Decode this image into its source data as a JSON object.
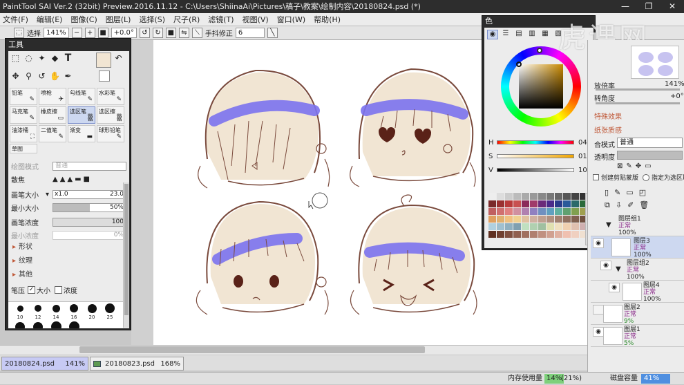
{
  "window": {
    "title": "PaintTool SAI Ver.2 (32bit) Preview.2016.11.12 - C:\\Users\\ShiinaAi\\Pictures\\稿子\\教案\\绘制内容\\20180824.psd (*)",
    "controls": [
      "—",
      "❐",
      "✕"
    ]
  },
  "menu": [
    "文件(F)",
    "编辑(E)",
    "图像(C)",
    "图层(L)",
    "选择(S)",
    "尺子(R)",
    "滤镜(T)",
    "视图(V)",
    "窗口(W)",
    "帮助(H)"
  ],
  "toolbar": {
    "select_label": "选择",
    "zoom": "141%",
    "angle": "+0.0°",
    "stabilizer_label": "手抖修正",
    "stabilizer_value": "6"
  },
  "tools_window": {
    "title": "工具",
    "brushes": [
      {
        "name": "铅笔",
        "glyph": "✎"
      },
      {
        "name": "喷枪",
        "glyph": "✈"
      },
      {
        "name": "勾线笔",
        "glyph": "✎"
      },
      {
        "name": "水彩笔",
        "glyph": "✎"
      },
      {
        "name": "马克笔",
        "glyph": "✎"
      },
      {
        "name": "橡皮擦",
        "glyph": "▭"
      },
      {
        "name": "选区笔",
        "glyph": "▒"
      },
      {
        "name": "选区擦",
        "glyph": "▒"
      },
      {
        "name": "油漆桶",
        "glyph": "⛶"
      },
      {
        "name": "二值笔",
        "glyph": "✎"
      },
      {
        "name": "渐变",
        "glyph": "▬"
      },
      {
        "name": "球形铅笔",
        "glyph": "✎"
      },
      {
        "name": "草图",
        "glyph": ""
      }
    ],
    "blend_mode_label": "绘图模式",
    "blend_mode_value": "普通",
    "scatter_label": "散焦",
    "brush_size_label": "画笔大小",
    "brush_size_mult": "x1.0",
    "brush_size_value": "23.0",
    "min_size_label": "最小大小",
    "min_size_value": "50%",
    "min_size_fraction": 0.5,
    "density_label": "画笔浓度",
    "density_value": "100",
    "min_density_label": "最小浓度",
    "min_density_value": "0%",
    "sections": [
      "形状",
      "纹理",
      "其他"
    ],
    "pressure_label": "笔压",
    "pressure_size": "大小",
    "pressure_density": "浓度",
    "dot_sizes": [
      "10",
      "12",
      "14",
      "16",
      "20",
      "25",
      "30",
      "35",
      "40",
      "50"
    ]
  },
  "color_window": {
    "title": "色",
    "h": {
      "label": "H",
      "value": "042"
    },
    "s": {
      "label": "S",
      "value": "011"
    },
    "v": {
      "label": "V",
      "value": "100"
    }
  },
  "layers_panel": {
    "magnify_label": "放倍率",
    "magnify_value": "141%",
    "rotate_label": "转角度",
    "rotate_value": "+0°",
    "effects_label": "特殊效果",
    "texture_label": "纸张质感",
    "mode_label": "合模式",
    "mode_value": "普通",
    "opacity_label": "透明度",
    "clip_label": "创建剪贴蒙版",
    "sel_source_label": "指定为选区取",
    "layers": [
      {
        "name": "图层组1",
        "mode": "正常",
        "opacity": "100%"
      },
      {
        "name": "图层3",
        "mode": "正常",
        "opacity": "100%"
      },
      {
        "name": "图层组2",
        "mode": "正常",
        "opacity": "100%"
      },
      {
        "name": "图层4",
        "mode": "正常",
        "opacity": "100%"
      },
      {
        "name": "图层2",
        "mode": "正常",
        "opacity": "9%"
      },
      {
        "name": "图层1",
        "mode": "正常",
        "opacity": "5%"
      }
    ]
  },
  "documents": [
    {
      "name": "20180824.psd",
      "zoom": "141%"
    },
    {
      "name": "20180823.psd",
      "zoom": "168%"
    }
  ],
  "status": {
    "memory_label": "内存使用量",
    "memory_value": "14%",
    "memory_extra": "(21%)",
    "disk_label": "磁盘容量",
    "disk_value": "41%"
  },
  "watermark": "虎课网",
  "colors": {
    "highlight": "#7b72ee",
    "line": "#7a4a3c",
    "skin": "#f1e5d3"
  }
}
